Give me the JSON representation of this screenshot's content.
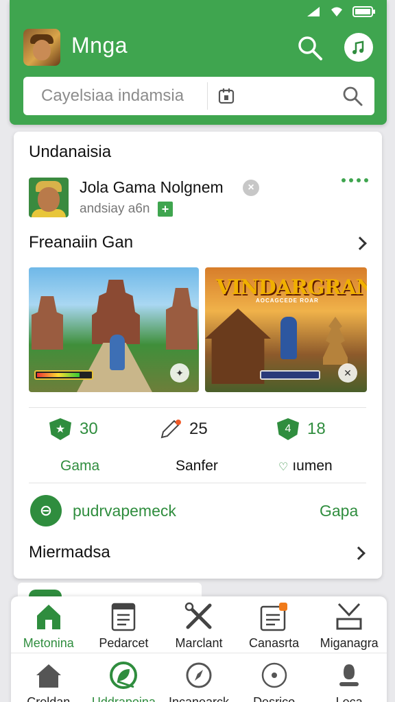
{
  "header": {
    "app_title": "Mnga",
    "search_placeholder": "Cayelsiaa indamsia",
    "accent_color": "#3fa54f"
  },
  "card": {
    "section_title": "Undanaisia",
    "game": {
      "name": "Jola Gama Nolgnem",
      "subtitle": "andsiay a6n",
      "add_label": "+"
    },
    "featured_title": "Freanaiin Gan",
    "thumbnails": [
      {
        "title": "",
        "banner": ""
      },
      {
        "title": "VINDARGRAN",
        "banner": "AOCAGCEDE ROAR"
      }
    ],
    "stats": [
      {
        "value": "30",
        "label": "Gama",
        "icon": "star-shield-icon"
      },
      {
        "value": "25",
        "label": "Sanfer",
        "icon": "pencil-icon"
      },
      {
        "value": "18",
        "label": "ıumen",
        "icon": "number-shield-icon"
      }
    ],
    "promo": {
      "text": "pudrvapemeck",
      "link": "Gapa"
    },
    "more_title": "Miermadsa"
  },
  "peek": {
    "text": "..."
  },
  "bottom_nav": {
    "row1": [
      {
        "label": "Metonina",
        "icon": "home-icon"
      },
      {
        "label": "Pedarcet",
        "icon": "document-icon"
      },
      {
        "label": "Marclant",
        "icon": "tools-icon"
      },
      {
        "label": "Canasrta",
        "icon": "notes-icon"
      },
      {
        "label": "Miganagra",
        "icon": "download-icon"
      }
    ],
    "row2": [
      {
        "label": "Creldan",
        "icon": "home-icon"
      },
      {
        "label": "Uddrapoina",
        "icon": "leaf-icon"
      },
      {
        "label": "Incanearck",
        "icon": "compass-icon"
      },
      {
        "label": "Desrico",
        "icon": "target-icon"
      },
      {
        "label": "Leca",
        "icon": "person-icon"
      }
    ]
  }
}
